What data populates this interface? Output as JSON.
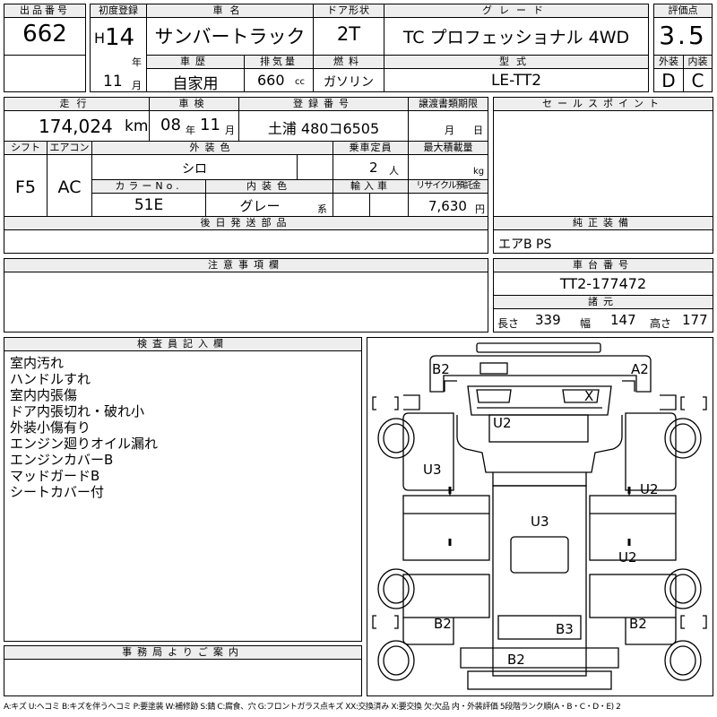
{
  "top": {
    "lot_label": "出品番号",
    "lot_value": "662",
    "first_reg_label": "初度登録",
    "era": "H",
    "year": "14",
    "year_unit": "年",
    "month": "11",
    "month_unit": "月",
    "car_name_label": "車名",
    "car_name": "サンバートラック",
    "door_label": "ドア形状",
    "door": "2T",
    "grade_label": "グレード",
    "grade": "TC プロフェッショナル 4WD",
    "score_label": "評価点",
    "score": "3.5",
    "history_label": "車歴",
    "history": "自家用",
    "displacement_label": "排気量",
    "displacement": "660",
    "displacement_unit": "cc",
    "fuel_label": "燃料",
    "fuel": "ガソリン",
    "model_label": "型式",
    "model": "LE-TT2",
    "ext_label": "外装",
    "ext_grade": "D",
    "int_label": "内装",
    "int_grade": "C"
  },
  "row2": {
    "mileage_label": "走行",
    "mileage": "174,024",
    "mileage_unit": "km",
    "inspection_label": "車検",
    "insp_year": "08",
    "insp_year_unit": "年",
    "insp_month": "11",
    "insp_month_unit": "月",
    "plate_label": "登録番号",
    "plate": "土浦 480コ6505",
    "transfer_label": "譲渡書類期限",
    "transfer_month_unit": "月",
    "transfer_day_unit": "日",
    "sales_label": "セールスポイント"
  },
  "row3": {
    "shift_label": "シフト",
    "shift": "F5",
    "ac_label": "エアコン",
    "ac": "AC",
    "ext_color_label": "外装色",
    "ext_color": "シロ",
    "capacity_label": "乗車定員",
    "capacity": "2",
    "capacity_unit": "人",
    "maxload_label": "最大積載量",
    "maxload_unit": "kg",
    "color_no_label": "カラーNo.",
    "color_no": "51E",
    "int_color_label": "内装色",
    "int_color": "グレー",
    "int_color_unit": "系",
    "import_label": "輸入車",
    "recycle_label": "リサイクル預託金",
    "recycle": "7,630",
    "recycle_unit": "円"
  },
  "later_parts_label": "後日発送部品",
  "genuine": {
    "label": "純正装備",
    "value": "エアB PS"
  },
  "caution_label": "注意事項欄",
  "chassis": {
    "label": "車台番号",
    "value": "TT2-177472"
  },
  "dims": {
    "label": "諸元",
    "length_label": "長さ",
    "length": "339",
    "width_label": "幅",
    "width": "147",
    "height_label": "高さ",
    "height": "177"
  },
  "inspector": {
    "label": "検査員記入欄",
    "notes": [
      "室内汚れ",
      "ハンドルすれ",
      "室内内張傷",
      "ドア内張切れ・破れ小",
      "外装小傷有り",
      "エンジン廻りオイル漏れ",
      "エンジンカバーB",
      "マッドガードB",
      "シートカバー付"
    ]
  },
  "office_label": "事務局よりご案内",
  "diagram_marks": {
    "front_left": "B2",
    "front_right": "A2",
    "windshield": "X",
    "roof": "U2",
    "left_door": "U3",
    "right_door": "U2",
    "floor": "U3",
    "right_rear_panel": "U2",
    "rear_left": "B2",
    "rear_right": "B2",
    "tailgate": "B3",
    "rear_bumper": "B2"
  },
  "legend": "A:キズ U:ヘコミ B:キズを伴うヘコミ P:要塗装 W:補修跡 S:錆 C:腐食、穴 G:フロントガラス点キズ XX:交換済み X:要交換 欠:欠品 内・外装評価 5段階ランク順(A・B・C・D・E) 2"
}
